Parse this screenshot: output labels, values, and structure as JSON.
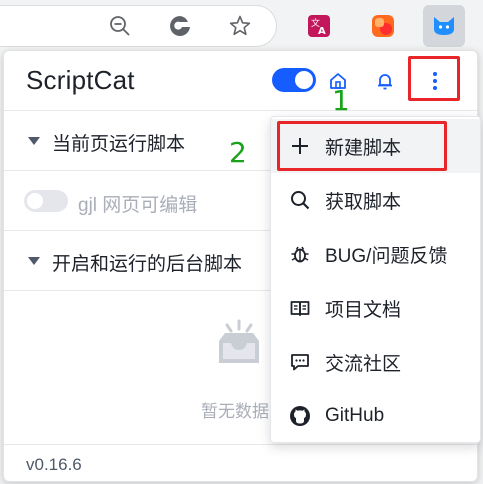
{
  "browser": {
    "toolbar_icons": [
      "zoom-out-icon",
      "edge-collections-icon",
      "favorite-star-icon"
    ],
    "extensions": [
      "translate-extension-icon",
      "orange-extension-icon",
      "scriptcat-extension-icon"
    ]
  },
  "popup": {
    "title": "ScriptCat",
    "enabled": true,
    "header_icons": [
      "home-icon",
      "bell-icon",
      "more-vertical-icon"
    ],
    "sections": {
      "current_page": "当前页运行脚本",
      "background": "开启和运行的后台脚本"
    },
    "scripts": [
      {
        "name": "gjl 网页可编辑",
        "enabled": false
      }
    ],
    "empty_text": "暂无数据",
    "version": "v0.16.6"
  },
  "menu": {
    "items": [
      {
        "label": "新建脚本",
        "icon": "plus-icon"
      },
      {
        "label": "获取脚本",
        "icon": "search-icon"
      },
      {
        "label": "BUG/问题反馈",
        "icon": "bug-icon"
      },
      {
        "label": "项目文档",
        "icon": "book-icon"
      },
      {
        "label": "交流社区",
        "icon": "message-icon"
      },
      {
        "label": "GitHub",
        "icon": "github-icon"
      }
    ]
  },
  "annotations": {
    "step1": "1",
    "step2": "2",
    "box_color": "#e8262a",
    "number_color": "#1aa31a"
  },
  "colors": {
    "accent": "#165dff",
    "text": "#1d2129",
    "muted": "#a9aeb8"
  }
}
